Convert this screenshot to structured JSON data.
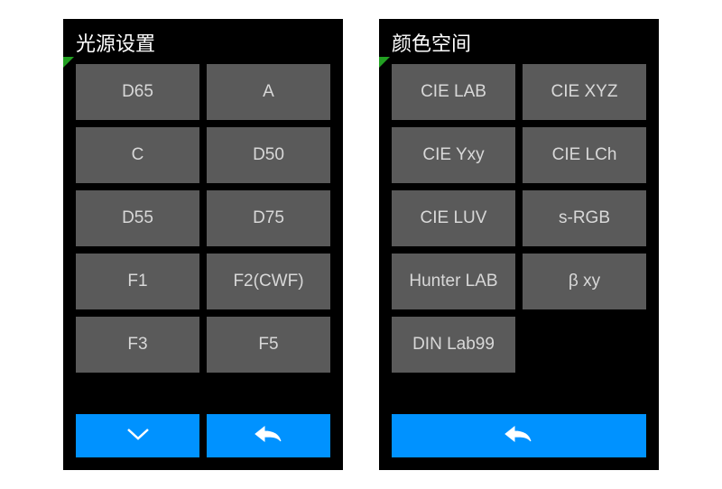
{
  "left_panel": {
    "title": "光源设置",
    "options": [
      "D65",
      "A",
      "C",
      "D50",
      "D55",
      "D75",
      "F1",
      "F2(CWF)",
      "F3",
      "F5"
    ],
    "footer": {
      "down_icon": "chevron-down",
      "back_icon": "back-arrow"
    }
  },
  "right_panel": {
    "title": "颜色空间",
    "options": [
      "CIE LAB",
      "CIE XYZ",
      "CIE Yxy",
      "CIE LCh",
      "CIE LUV",
      "s-RGB",
      "Hunter LAB",
      "β xy",
      "DIN Lab99"
    ],
    "footer": {
      "back_icon": "back-arrow"
    }
  },
  "colors": {
    "accent": "#0092ff",
    "option_bg": "#5a5a5a",
    "marker": "#22a022"
  }
}
